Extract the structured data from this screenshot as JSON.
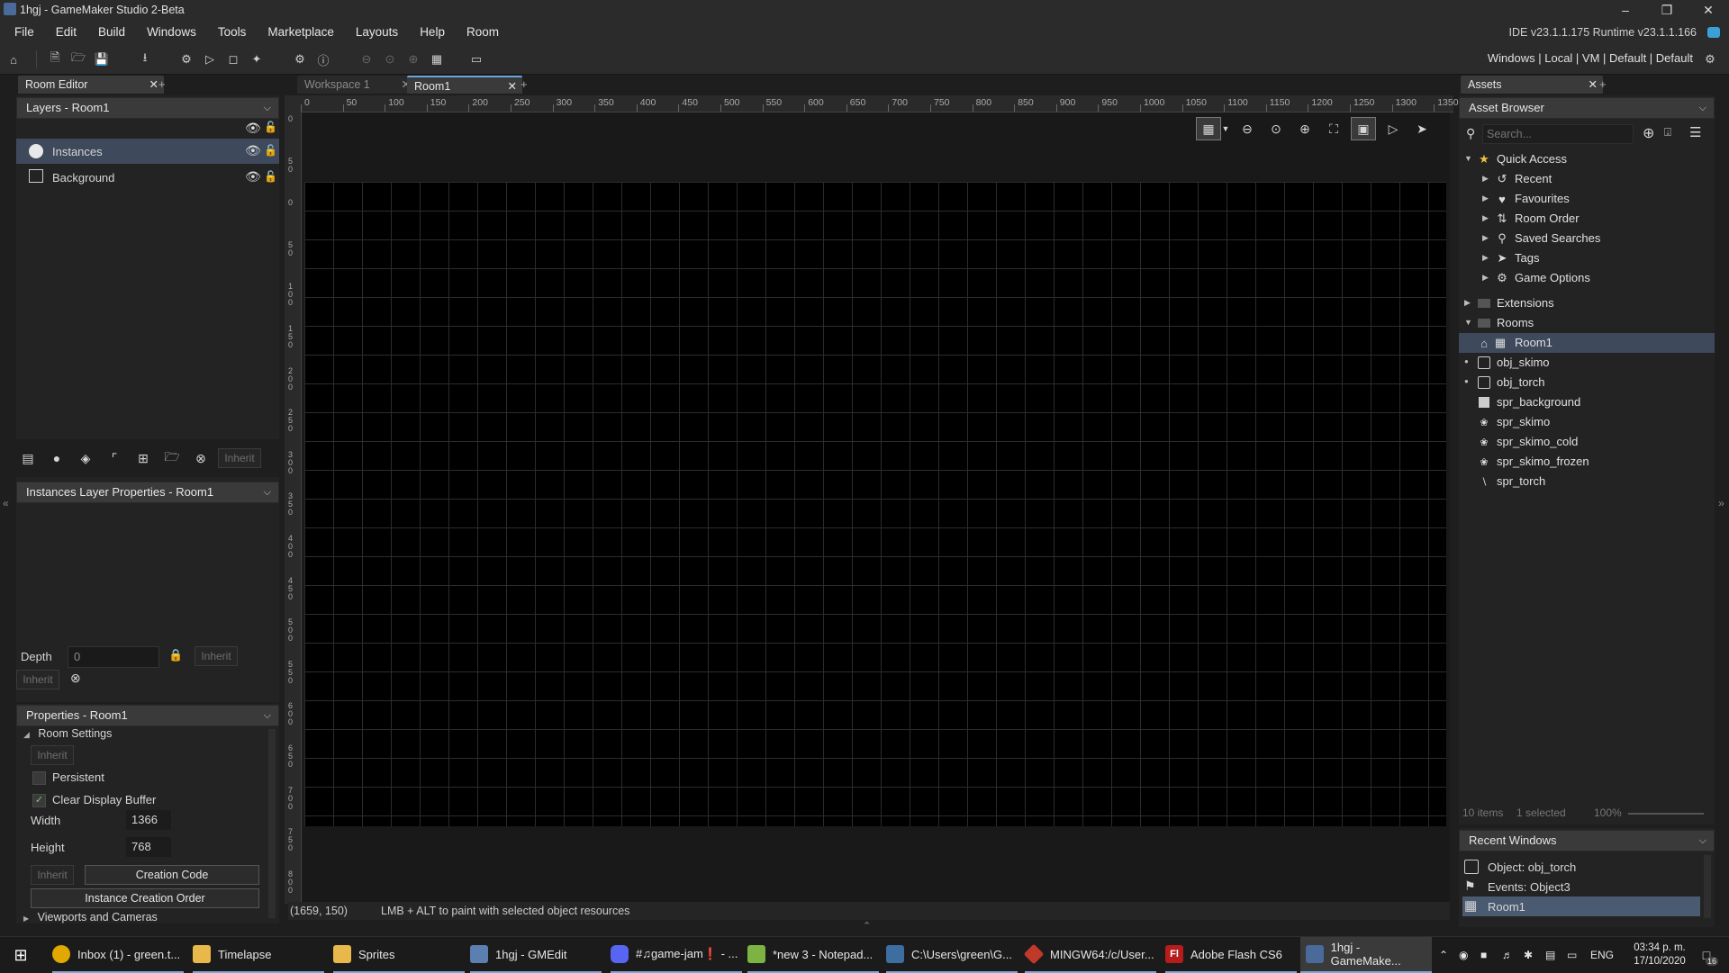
{
  "window": {
    "title": "1hgj - GameMaker Studio 2-Beta",
    "ide_version": "IDE v23.1.1.175  Runtime v23.1.1.166"
  },
  "menu": [
    "File",
    "Edit",
    "Build",
    "Windows",
    "Tools",
    "Marketplace",
    "Layouts",
    "Help",
    "Room"
  ],
  "targets": "Windows  |  Local  |  VM  |  Default  |  Default",
  "left": {
    "tab": "Room Editor",
    "layers_header": "Layers - Room1",
    "layers": [
      {
        "name": "Instances",
        "icon": "instance-layer-icon"
      },
      {
        "name": "Background",
        "icon": "background-layer-icon"
      }
    ],
    "inherit_label": "Inherit",
    "instance_props_header": "Instances Layer Properties - Room1",
    "depth_label": "Depth",
    "depth_value": "0",
    "properties_header": "Properties - Room1",
    "room_settings_label": "Room Settings",
    "persistent_label": "Persistent",
    "persistent_checked": false,
    "clear_buffer_label": "Clear Display Buffer",
    "clear_buffer_checked": true,
    "width_label": "Width",
    "width_value": "1366",
    "height_label": "Height",
    "height_value": "768",
    "creation_code_label": "Creation Code",
    "instance_order_label": "Instance Creation Order",
    "viewports_label": "Viewports and Cameras"
  },
  "center": {
    "tabs": [
      {
        "label": "Workspace 1",
        "active": false
      },
      {
        "label": "Room1",
        "active": true
      }
    ],
    "ruler_top": [
      "0",
      "50",
      "100",
      "150",
      "200",
      "250",
      "300",
      "350",
      "400",
      "450",
      "500",
      "550",
      "600",
      "650",
      "700",
      "750",
      "800",
      "850",
      "900",
      "950",
      "1000",
      "1050",
      "1100",
      "1150",
      "1200",
      "1250",
      "1300",
      "1350"
    ],
    "ruler_left": [
      "0",
      "50",
      "0",
      "50",
      "100",
      "150",
      "200",
      "250",
      "300",
      "350",
      "400",
      "450",
      "500",
      "550",
      "600",
      "650",
      "700",
      "750",
      "800"
    ],
    "status_coords": "(1659, 150)",
    "status_hint": "LMB + ALT to paint with selected object resources"
  },
  "right": {
    "tab": "Assets",
    "header": "Asset Browser",
    "search_placeholder": "Search...",
    "quick_access": "Quick Access",
    "quick_items": [
      "Recent",
      "Favourites",
      "Room Order",
      "Saved Searches",
      "Tags",
      "Game Options"
    ],
    "extensions": "Extensions",
    "rooms": "Rooms",
    "room1": "Room1",
    "objects": [
      "obj_skimo",
      "obj_torch"
    ],
    "sprites": [
      "spr_background",
      "spr_skimo",
      "spr_skimo_cold",
      "spr_skimo_frozen",
      "spr_torch"
    ],
    "footer_items": "10 items",
    "footer_selected": "1 selected",
    "footer_zoom": "100%",
    "recent_header": "Recent Windows",
    "recent": [
      "Object: obj_torch",
      "Events: Object3",
      "Room1"
    ]
  },
  "taskbar": {
    "apps": [
      {
        "label": "Inbox (1) - green.t...",
        "color": "#e0a800"
      },
      {
        "label": "Timelapse",
        "color": "#e8b84a"
      },
      {
        "label": "Sprites",
        "color": "#e8b84a"
      },
      {
        "label": "1hgj - GMEdit",
        "color": "#5a7fb0"
      },
      {
        "label": "#♫game-jam❗ - ...",
        "color": "#5865f2"
      },
      {
        "label": "*new 3 - Notepad...",
        "color": "#7cb342"
      },
      {
        "label": "C:\\Users\\green\\G...",
        "color": "#3c6ea0"
      },
      {
        "label": "MINGW64:/c/User...",
        "color": "#c0392b"
      },
      {
        "label": "Adobe Flash CS6",
        "color": "#b71c1c"
      },
      {
        "label": "1hgj - GameMake...",
        "color": "#4a6a9a"
      }
    ],
    "flash_glyph": "Fl",
    "lang": "ENG",
    "time": "03:34 p. m.",
    "date": "17/10/2020",
    "notif_count": "16"
  }
}
